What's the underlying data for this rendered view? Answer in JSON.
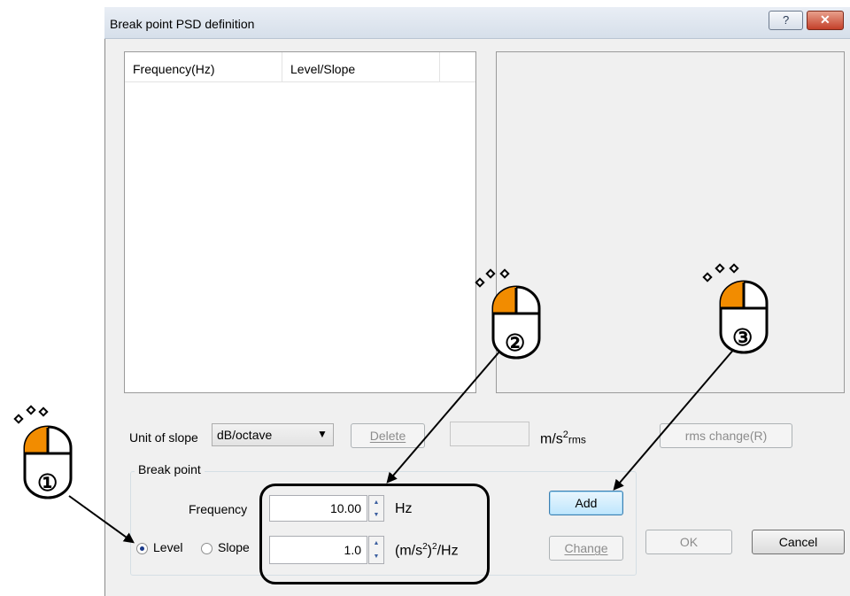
{
  "dialog": {
    "title": "Break point PSD definition",
    "help_glyph": "?",
    "close_glyph": "✕"
  },
  "list": {
    "columns": [
      "Frequency(Hz)",
      "Level/Slope"
    ]
  },
  "slope": {
    "label": "Unit of slope",
    "value": "dB/octave",
    "delete_label": "Delete",
    "rms_value": "",
    "rms_unit": "m/s",
    "rms_unit_sup": "2",
    "rms_unit_sub": "rms",
    "rms_change_label": "rms change(R)"
  },
  "break_point": {
    "group_label": "Break point",
    "frequency_label": "Frequency",
    "frequency_value": "10.00",
    "frequency_unit": "Hz",
    "level_label": "Level",
    "slope_label": "Slope",
    "level_value": "1.0",
    "level_unit_a": "(m/s",
    "level_unit_sup1": "2",
    "level_unit_b": ")",
    "level_unit_sup2": "2",
    "level_unit_c": "/Hz",
    "selected_mode": "Level"
  },
  "buttons": {
    "add": "Add",
    "change": "Change",
    "ok": "OK",
    "cancel": "Cancel"
  },
  "annotations": {
    "step1": "①",
    "step2": "②",
    "step3": "③",
    "mouse_accent": "#f28c00"
  }
}
